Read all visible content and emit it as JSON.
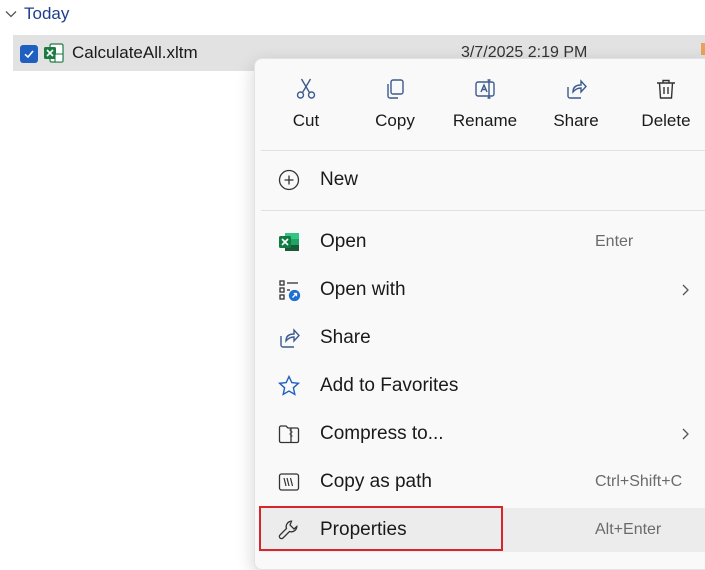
{
  "group": {
    "label": "Today"
  },
  "file": {
    "name": "CalculateAll.xltm",
    "date": "3/7/2025 2:19 PM"
  },
  "menu": {
    "quick_actions": [
      {
        "label": "Cut",
        "icon": "scissors-icon"
      },
      {
        "label": "Copy",
        "icon": "copy-icon"
      },
      {
        "label": "Rename",
        "icon": "rename-icon"
      },
      {
        "label": "Share",
        "icon": "share-icon"
      },
      {
        "label": "Delete",
        "icon": "trash-icon"
      }
    ],
    "items": [
      {
        "label": "New",
        "icon": "plus-circle-icon"
      },
      {
        "label": "Open",
        "shortcut": "Enter",
        "icon": "excel-icon"
      },
      {
        "label": "Open with",
        "icon": "open-with-icon",
        "submenu": true
      },
      {
        "label": "Share",
        "icon": "share-icon"
      },
      {
        "label": "Add to Favorites",
        "icon": "star-icon"
      },
      {
        "label": "Compress to...",
        "icon": "zip-folder-icon",
        "submenu": true
      },
      {
        "label": "Copy as path",
        "shortcut": "Ctrl+Shift+C",
        "icon": "copy-path-icon"
      },
      {
        "label": "Properties",
        "shortcut": "Alt+Enter",
        "icon": "wrench-icon"
      }
    ]
  },
  "colors": {
    "accent": "#1f5fbf",
    "highlight_box": "#d7262b",
    "excel_green": "#1d7a43"
  }
}
